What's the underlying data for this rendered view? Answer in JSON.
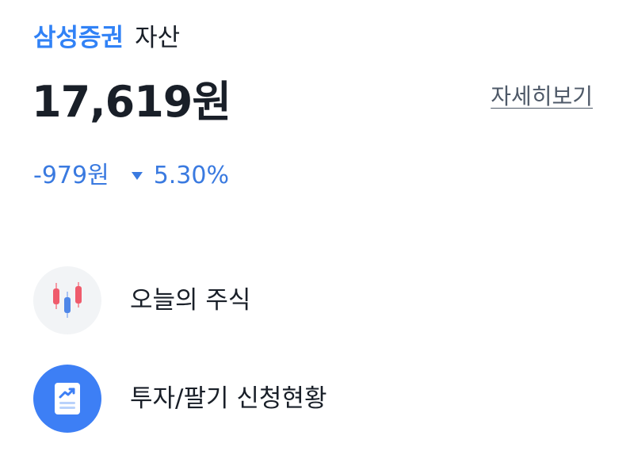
{
  "header": {
    "broker_name": "삼성증권",
    "asset_label": "자산"
  },
  "summary": {
    "total_amount": "17,619원",
    "detail_link": "자세히보기",
    "change_amount": "-979원",
    "change_rate": "5.30%",
    "change_direction": "down",
    "change_color": "#3a7ae0"
  },
  "menu": {
    "items": [
      {
        "label": "오늘의 주식",
        "icon": "candlestick-chart-icon"
      },
      {
        "label": "투자/팔기 신청현황",
        "icon": "trend-document-icon"
      }
    ]
  },
  "colors": {
    "brand": "#3182f6",
    "text_primary": "#191f28",
    "text_secondary": "#4e5968"
  }
}
